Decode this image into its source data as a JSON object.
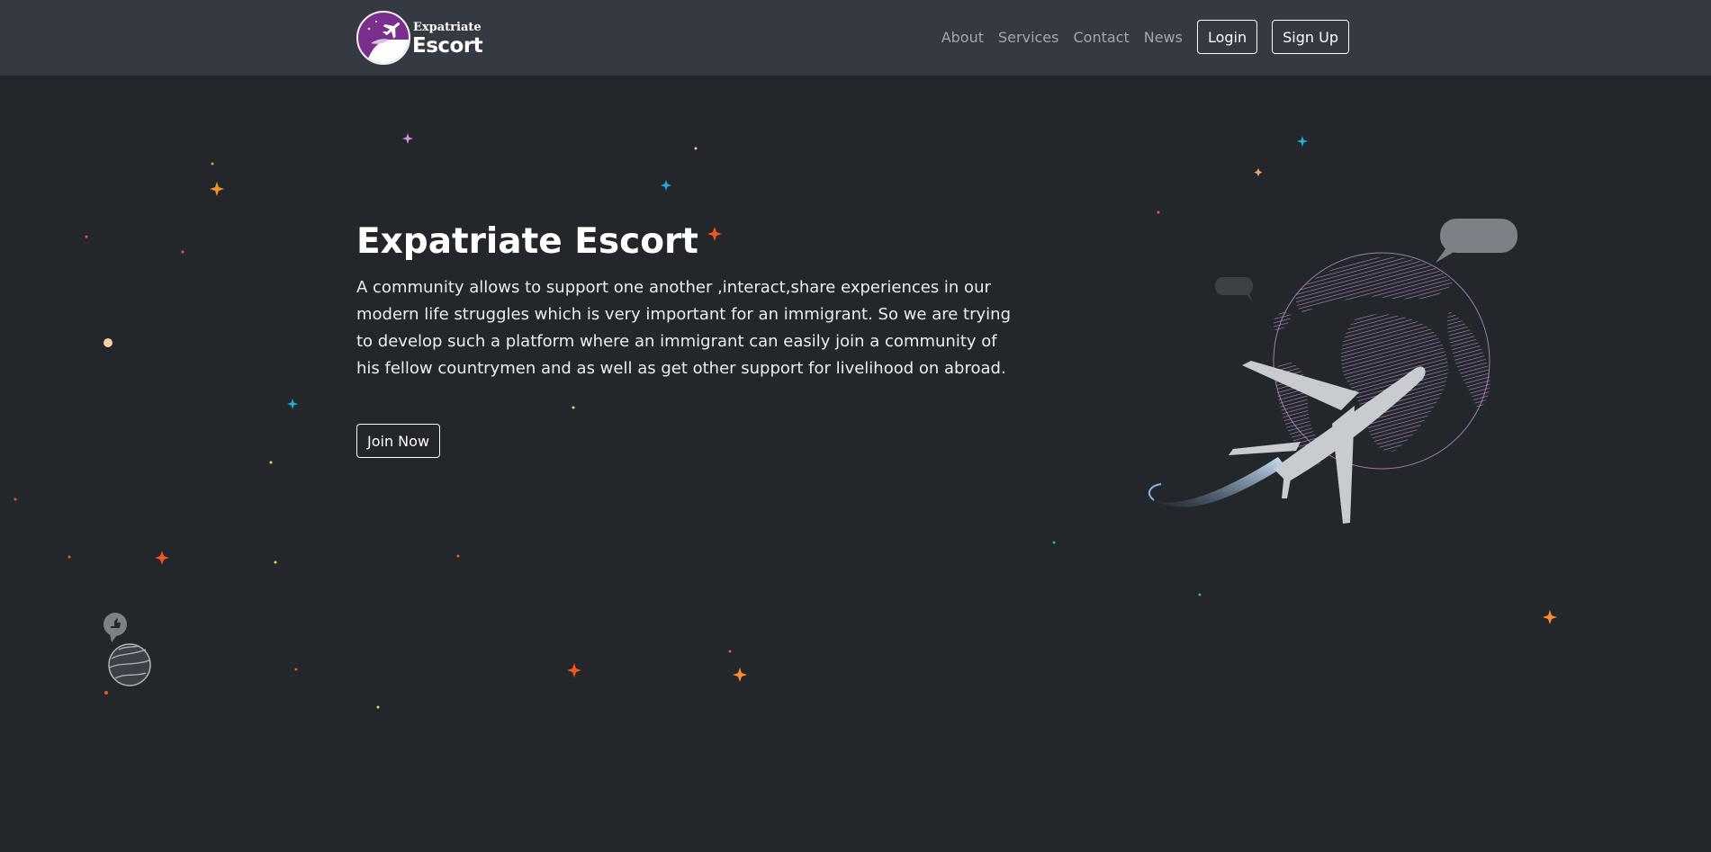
{
  "navbar": {
    "brand_small": "Expatriate",
    "brand_big": "Escort",
    "links": [
      "About",
      "Services",
      "Contact",
      "News"
    ],
    "login_label": "Login",
    "signup_label": "Sign Up"
  },
  "hero": {
    "title": "Expatriate Escort",
    "description": "A community allows to support one another ,interact,share experiences in our modern life struggles which is very important for an immigrant. So we are trying to develop such a platform where an immigrant can easily join a community of his fellow countrymen and as well as get other support for livelihood on abroad.",
    "join_label": "Join Now"
  },
  "icons": {
    "logo": "airplane-logo-icon",
    "hero_illustration": "globe-airplane-icon",
    "planet": "planet-thumbs-up-icon"
  },
  "colors": {
    "navbar_bg": "#353942",
    "page_bg": "#23272c",
    "brand_purple": "#7b2f8c",
    "nav_link": "#a3a7ab"
  }
}
